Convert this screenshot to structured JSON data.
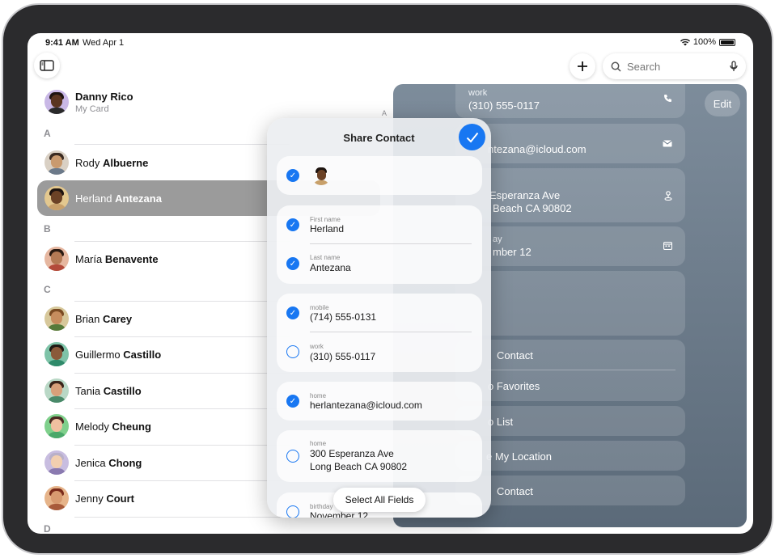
{
  "status": {
    "time": "9:41 AM",
    "date": "Wed Apr 1",
    "battery": "100%"
  },
  "toolbar": {
    "search_placeholder": "Search",
    "add_label": "+"
  },
  "my_card": {
    "name_first": "Danny",
    "name_last": "Rico",
    "subtitle": "My Card"
  },
  "sections": [
    "A",
    "B",
    "C",
    "D"
  ],
  "contacts": [
    {
      "first": "Rody",
      "last": "Albuerne",
      "skin": "#c99a6e",
      "hair": "#3a2a20",
      "shirt": "#6c7a8a",
      "bg": "#d9d0c4"
    },
    {
      "first": "Herland",
      "last": "Antezana",
      "skin": "#6b4226",
      "hair": "#1e1410",
      "shirt": "#c8a06a",
      "bg": "#e3c88f"
    },
    {
      "first": "María",
      "last": "Benavente",
      "skin": "#b57a55",
      "hair": "#2a1a12",
      "shirt": "#b34a3a",
      "bg": "#e6b7a0"
    },
    {
      "first": "Brian",
      "last": "Carey",
      "skin": "#c78d5e",
      "hair": "#7a4a22",
      "shirt": "#577a3a",
      "bg": "#d7c89b"
    },
    {
      "first": "Guillermo",
      "last": "Castillo",
      "skin": "#8a5a3a",
      "hair": "#1f1a14",
      "shirt": "#2f8a6a",
      "bg": "#7ec3a8"
    },
    {
      "first": "Tania",
      "last": "Castillo",
      "skin": "#d8a07a",
      "hair": "#3a241a",
      "shirt": "#4a8a6a",
      "bg": "#b9d8c6"
    },
    {
      "first": "Melody",
      "last": "Cheung",
      "skin": "#f0c0a0",
      "hair": "#4a2a22",
      "shirt": "#4aa86a",
      "bg": "#7fd08c"
    },
    {
      "first": "Jenica",
      "last": "Chong",
      "skin": "#f2cfb0",
      "hair": "#b9b0c8",
      "shirt": "#8a7ab0",
      "bg": "#c8bde0"
    },
    {
      "first": "Jenny",
      "last": "Court",
      "skin": "#d89a70",
      "hair": "#7a2a1a",
      "shirt": "#a85a3a",
      "bg": "#e6b48a"
    }
  ],
  "index_letter": "A",
  "detail": {
    "edit": "Edit",
    "work_label": "work",
    "work_phone": "(310) 555-0117",
    "email_partial": "ntezana@icloud.com",
    "address_line1_partial": "Esperanza Ave",
    "address_line2_partial": "Beach CA 90802",
    "birthday_label_partial": "ay",
    "birthday_value_partial": "mber 12",
    "action_1": "Contact",
    "action_2": "o Favorites",
    "action_3": "o List",
    "action_4": "e My Location",
    "action_5": "Contact"
  },
  "share": {
    "title": "Share Contact",
    "select_all": "Select All Fields",
    "fields": [
      {
        "label": "First name",
        "value": "Herland",
        "checked": true
      },
      {
        "label": "Last name",
        "value": "Antezana",
        "checked": true
      },
      {
        "label": "mobile",
        "value": "(714) 555-0131",
        "checked": true
      },
      {
        "label": "work",
        "value": "(310) 555-0117",
        "checked": false
      },
      {
        "label": "home",
        "value": "herlantezana@icloud.com",
        "checked": true
      },
      {
        "label": "home",
        "value_line1": "300 Esperanza Ave",
        "value_line2": "Long Beach CA 90802",
        "checked": false
      },
      {
        "label": "birthday",
        "value": "November 12",
        "checked": false
      }
    ]
  },
  "colors": {
    "accent": "#1877f2",
    "detail_bg": "#6a7a8a",
    "selected_row": "#9b9b9b"
  }
}
